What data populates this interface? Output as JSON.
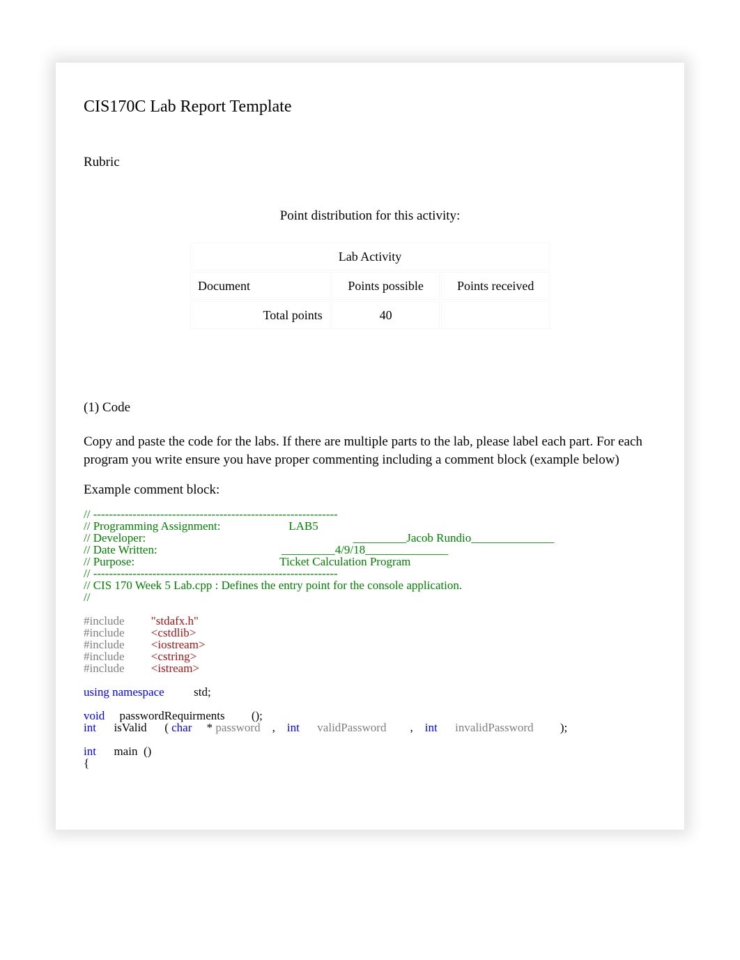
{
  "title": "CIS170C Lab Report Template",
  "rubric_heading": "Rubric",
  "distribution_label": "Point distribution for this activity:",
  "table": {
    "lab_activity": "Lab Activity",
    "col1": "Document",
    "col2": "Points possible",
    "col3": "Points received",
    "total_label": "Total points",
    "total_value": "40"
  },
  "section1": {
    "heading": "(1) Code",
    "paragraph": "Copy and paste the code for the labs. If there are multiple parts to the lab, please label each part. For each program you write ensure you have proper commenting including a comment block (example below)",
    "example_label": "Example comment block:"
  },
  "code": {
    "divider": "// --------------------------------------------------------------",
    "assign_label": "// Programming Assignment:",
    "assign_value": "LAB5",
    "dev_label": "// Developer:",
    "dev_value": "_________Jacob Rundio______________",
    "date_label": "// Date Written:",
    "date_value": "_________4/9/18______________",
    "purpose_label": "// Purpose:",
    "purpose_value": "Ticket Calculation Program",
    "entry_comment": "// CIS 170 Week 5 Lab.cpp : Defines the entry point for the console application.",
    "empty_comment": "//",
    "include": "#include",
    "inc1": "\"stdafx.h\"",
    "inc2": "<cstdlib>",
    "inc3": "<iostream>",
    "inc4": "<cstring>",
    "inc5": "<istream>",
    "using_ns": "using namespace",
    "std": "std;",
    "void": "void",
    "passreq": "passwordRequirments",
    "paren_empty": "();",
    "int": "int",
    "isvalid": "isValid",
    "paren_open": "(",
    "char": "char",
    "star": "*",
    "password": "password",
    "comma": ",",
    "validpw": "validPassword",
    "invalidpw": "invalidPassword",
    "paren_close": ");",
    "main": "main",
    "main_paren": "()",
    "brace": "{"
  }
}
